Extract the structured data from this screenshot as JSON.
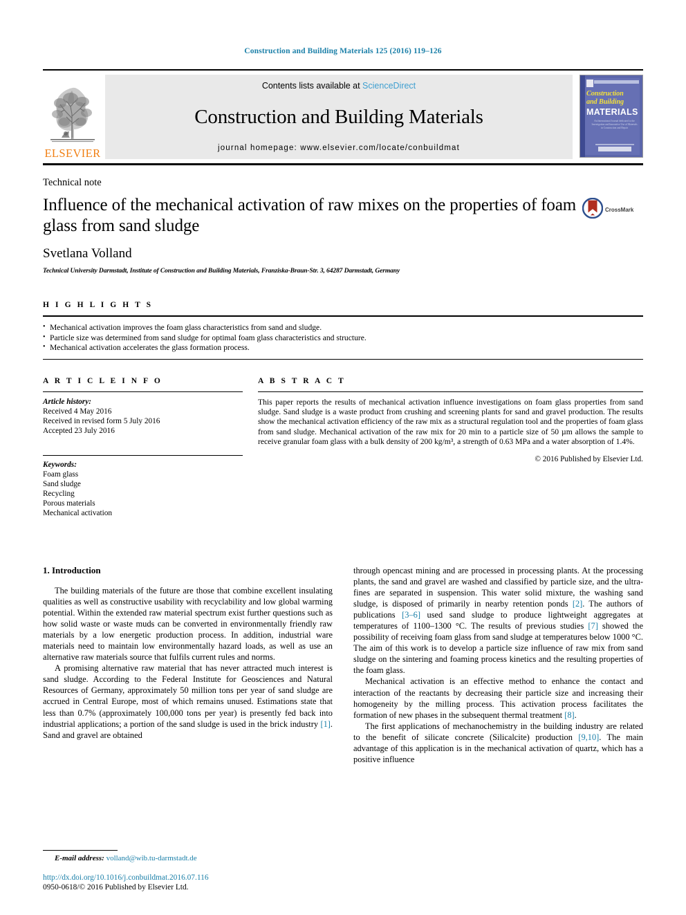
{
  "running_head": "Construction and Building Materials 125 (2016) 119–126",
  "masthead": {
    "publisher_name": "ELSEVIER",
    "contents_prefix": "Contents lists available at ",
    "contents_link": "ScienceDirect",
    "journal_title": "Construction and Building Materials",
    "homepage_line": "journal homepage: www.elsevier.com/locate/conbuildmat",
    "cover": {
      "line1": "Construction",
      "line2": "and Building",
      "line3": "MATERIALS",
      "blurb": "An International Journal dedicated to the Investigation and Innovative Use of Materials in Construction and Repair"
    }
  },
  "article": {
    "type": "Technical note",
    "title": "Influence of the mechanical activation of raw mixes on the properties of foam glass from sand sludge",
    "author": "Svetlana Volland",
    "affiliation": "Technical University Darmstadt, Institute of Construction and Building Materials, Franziska-Braun-Str. 3, 64287 Darmstadt, Germany",
    "crossmark_label": "CrossMark"
  },
  "highlights": {
    "heading": "H I G H L I G H T S",
    "items": [
      "Mechanical activation improves the foam glass characteristics from sand and sludge.",
      "Particle size was determined from sand sludge for optimal foam glass characteristics and structure.",
      "Mechanical activation accelerates the glass formation process."
    ]
  },
  "article_info": {
    "heading": "A R T I C L E   I N F O",
    "history_label": "Article history:",
    "history": [
      "Received 4 May 2016",
      "Received in revised form 5 July 2016",
      "Accepted 23 July 2016"
    ],
    "keywords_label": "Keywords:",
    "keywords": [
      "Foam glass",
      "Sand sludge",
      "Recycling",
      "Porous materials",
      "Mechanical activation"
    ]
  },
  "abstract": {
    "heading": "A B S T R A C T",
    "text": "This paper reports the results of mechanical activation influence investigations on foam glass properties from sand sludge. Sand sludge is a waste product from crushing and screening plants for sand and gravel production. The results show the mechanical activation efficiency of the raw mix as a structural regulation tool and the properties of foam glass from sand sludge. Mechanical activation of the raw mix for 20 min to a particle size of 50 µm allows the sample to receive granular foam glass with a bulk density of 200 kg/m³, a strength of 0.63 MPa and a water absorption of 1.4%.",
    "copyright": "© 2016 Published by Elsevier Ltd."
  },
  "introduction": {
    "heading": "1. Introduction",
    "left_paragraphs": [
      "The building materials of the future are those that combine excellent insulating qualities as well as constructive usability with recyclability and low global warming potential. Within the extended raw material spectrum exist further questions such as how solid waste or waste muds can be converted in environmentally friendly raw materials by a low energetic production process. In addition, industrial ware materials need to maintain low environmentally hazard loads, as well as use an alternative raw materials source that fulfils current rules and norms.",
      "A promising alternative raw material that has never attracted much interest is sand sludge. According to the Federal Institute for Geosciences and Natural Resources of Germany, approximately 50 million tons per year of sand sludge are accrued in Central Europe, most of which remains unused. Estimations state that less than 0.7% (approximately 100,000 tons per year) is presently fed back into industrial applications; a portion of the sand sludge is used in the brick industry [1]. Sand and gravel are obtained"
    ],
    "right_paragraphs": [
      "through opencast mining and are processed in processing plants. At the processing plants, the sand and gravel are washed and classified by particle size, and the ultra-fines are separated in suspension. This water solid mixture, the washing sand sludge, is disposed of primarily in nearby retention ponds [2]. The authors of publications [3–6] used sand sludge to produce lightweight aggregates at temperatures of 1100–1300 °C. The results of previous studies [7] showed the possibility of receiving foam glass from sand sludge at temperatures below 1000 °C. The aim of this work is to develop a particle size influence of raw mix from sand sludge on the sintering and foaming process kinetics and the resulting properties of the foam glass.",
      "Mechanical activation is an effective method to enhance the contact and interaction of the reactants by decreasing their particle size and increasing their homogeneity by the milling process. This activation process facilitates the formation of new phases in the subsequent thermal treatment [8].",
      "The first applications of mechanochemistry in the building industry are related to the benefit of silicate concrete (Silicalcite) production [9,10]. The main advantage of this application is in the mechanical activation of quartz, which has a positive influence"
    ]
  },
  "footer": {
    "email_label": "E-mail address:",
    "email": "volland@wib.tu-darmstadt.de",
    "doi": "http://dx.doi.org/10.1016/j.conbuildmat.2016.07.116",
    "issn_line": "0950-0618/© 2016 Published by Elsevier Ltd."
  },
  "colors": {
    "link_blue": "#1a7fa8",
    "sciencedirect_blue": "#3f9fd0",
    "elsevier_orange": "#f07f13",
    "cover_blue": "#6670b4",
    "cover_yellow": "#f3e03a",
    "crossmark_red": "#b02d20",
    "crossmark_blue": "#2d4f8e"
  }
}
